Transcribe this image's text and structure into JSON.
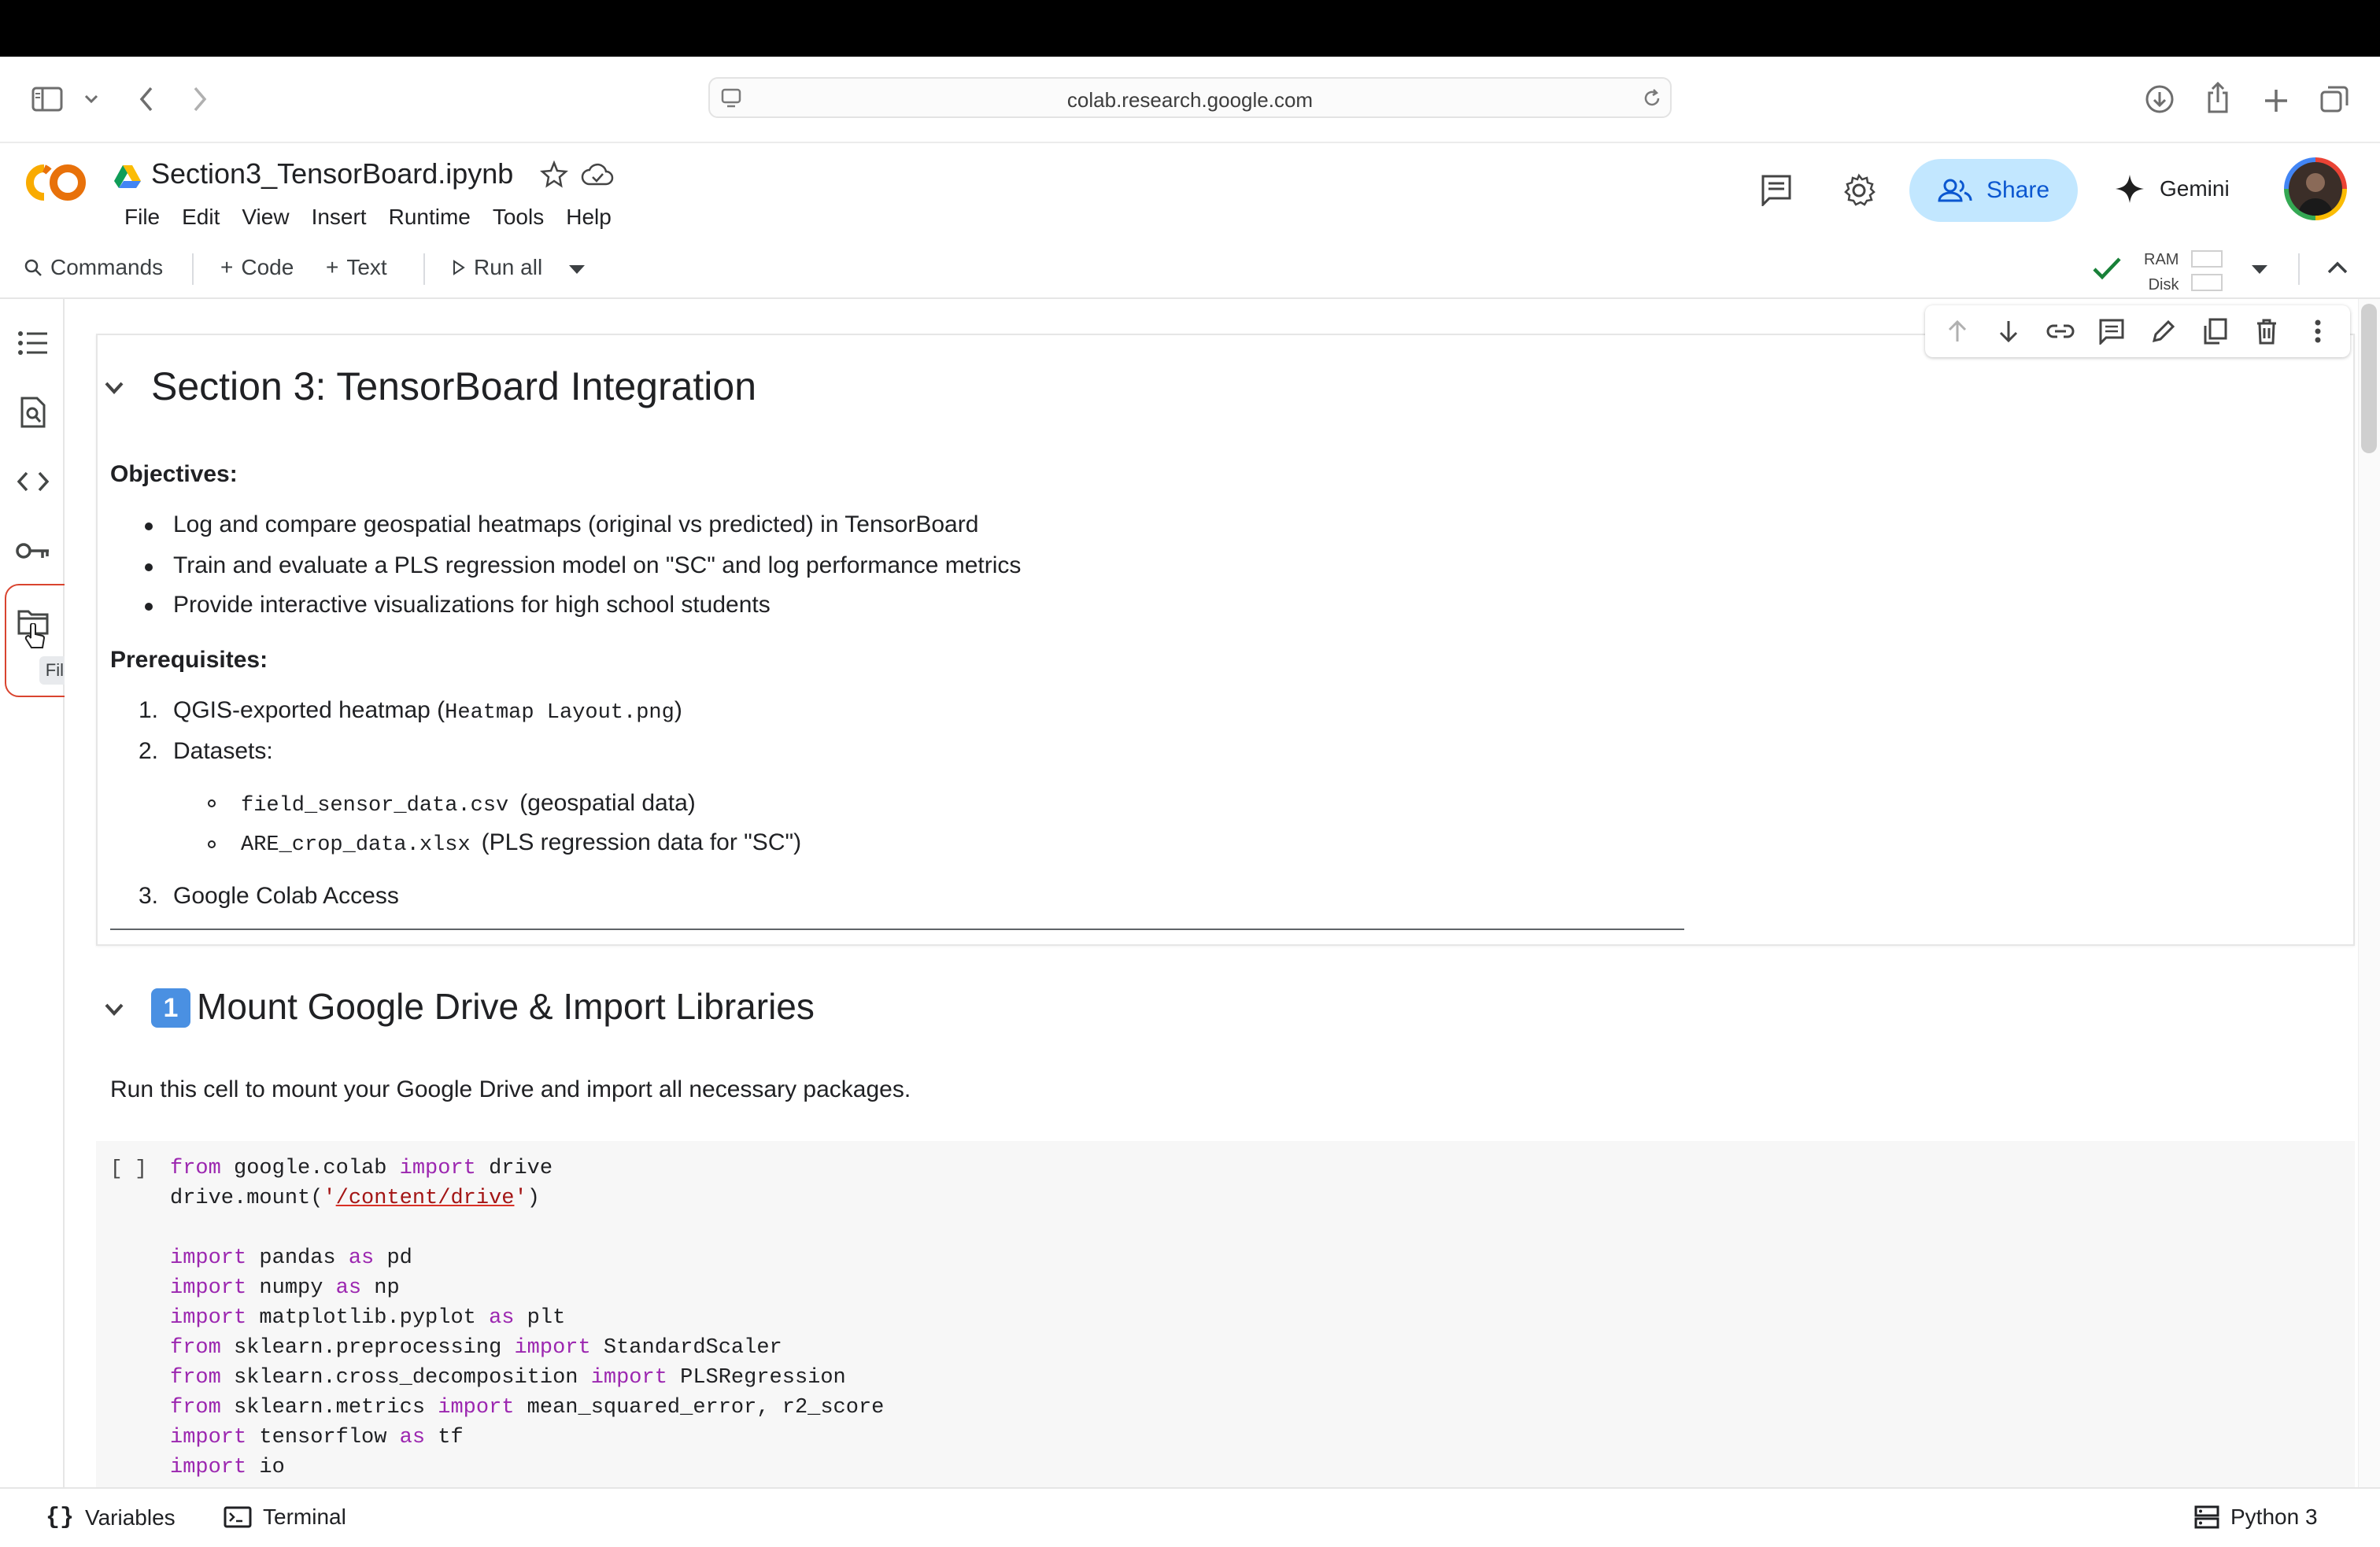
{
  "browser": {
    "url": "colab.research.google.com"
  },
  "colab": {
    "notebook_title": "Section3_TensorBoard.ipynb",
    "menu": [
      "File",
      "Edit",
      "View",
      "Insert",
      "Runtime",
      "Tools",
      "Help"
    ],
    "share_label": "Share",
    "gemini_label": "Gemini"
  },
  "toolbar": {
    "commands": "Commands",
    "code": "Code",
    "text": "Text",
    "run_all": "Run all",
    "ram": "RAM",
    "disk": "Disk"
  },
  "sidebar": {
    "files_tooltip": "Files"
  },
  "cell1": {
    "heading": "Section 3: TensorBoard Integration",
    "objectives_label": "Objectives:",
    "objectives": [
      "Log and compare geospatial heatmaps (original vs predicted) in TensorBoard",
      "Train and evaluate a PLS regression model on \"SC\" and log performance metrics",
      "Provide interactive visualizations for high school students"
    ],
    "prereq_label": "Prerequisites:",
    "prereq1_text": "QGIS-exported heatmap (",
    "prereq1_code": "Heatmap Layout.png",
    "prereq1_close": ")",
    "prereq2": "Datasets:",
    "datasets": [
      {
        "code": "field_sensor_data.csv",
        "desc": "(geospatial data)"
      },
      {
        "code": "ARE_crop_data.xlsx",
        "desc": "(PLS regression data for \"SC\")"
      }
    ],
    "prereq3": "Google Colab Access",
    "numbers": [
      "1.",
      "2.",
      "3."
    ]
  },
  "cell2": {
    "heading_emoji": "1️⃣",
    "heading": "Mount Google Drive & Import Libraries",
    "description": "Run this cell to mount your Google Drive and import all necessary packages.",
    "run_indicator": "[ ]"
  },
  "code": {
    "line1": {
      "kw1": "from",
      "mod": " google.colab ",
      "kw2": "import",
      "rest": " drive"
    },
    "line2": {
      "pre": "drive.mount(",
      "q1": "'",
      "path": "/content/drive",
      "q2": "'",
      "post": ")"
    },
    "imports": [
      {
        "a": "import",
        "b": " pandas ",
        "c": "as",
        "d": " pd"
      },
      {
        "a": "import",
        "b": " numpy ",
        "c": "as",
        "d": " np"
      },
      {
        "a": "import",
        "b": " matplotlib.pyplot ",
        "c": "as",
        "d": " plt"
      },
      {
        "a": "from",
        "b": " sklearn.preprocessing ",
        "c": "import",
        "d": " StandardScaler"
      },
      {
        "a": "from",
        "b": " sklearn.cross_decomposition ",
        "c": "import",
        "d": " PLSRegression"
      },
      {
        "a": "from",
        "b": " sklearn.metrics ",
        "c": "import",
        "d": " mean_squared_error, r2_score"
      },
      {
        "a": "import",
        "b": " tensorflow ",
        "c": "as",
        "d": " tf"
      },
      {
        "a": "import",
        "b": " io",
        "c": "",
        "d": ""
      }
    ]
  },
  "bottom": {
    "variables": "Variables",
    "terminal": "Terminal",
    "runtime": "Python 3"
  },
  "colors": {
    "keyword": "#9c27b0",
    "string": "#a31515",
    "share_bg": "#c2e7ff",
    "highlight": "#d9442f"
  }
}
